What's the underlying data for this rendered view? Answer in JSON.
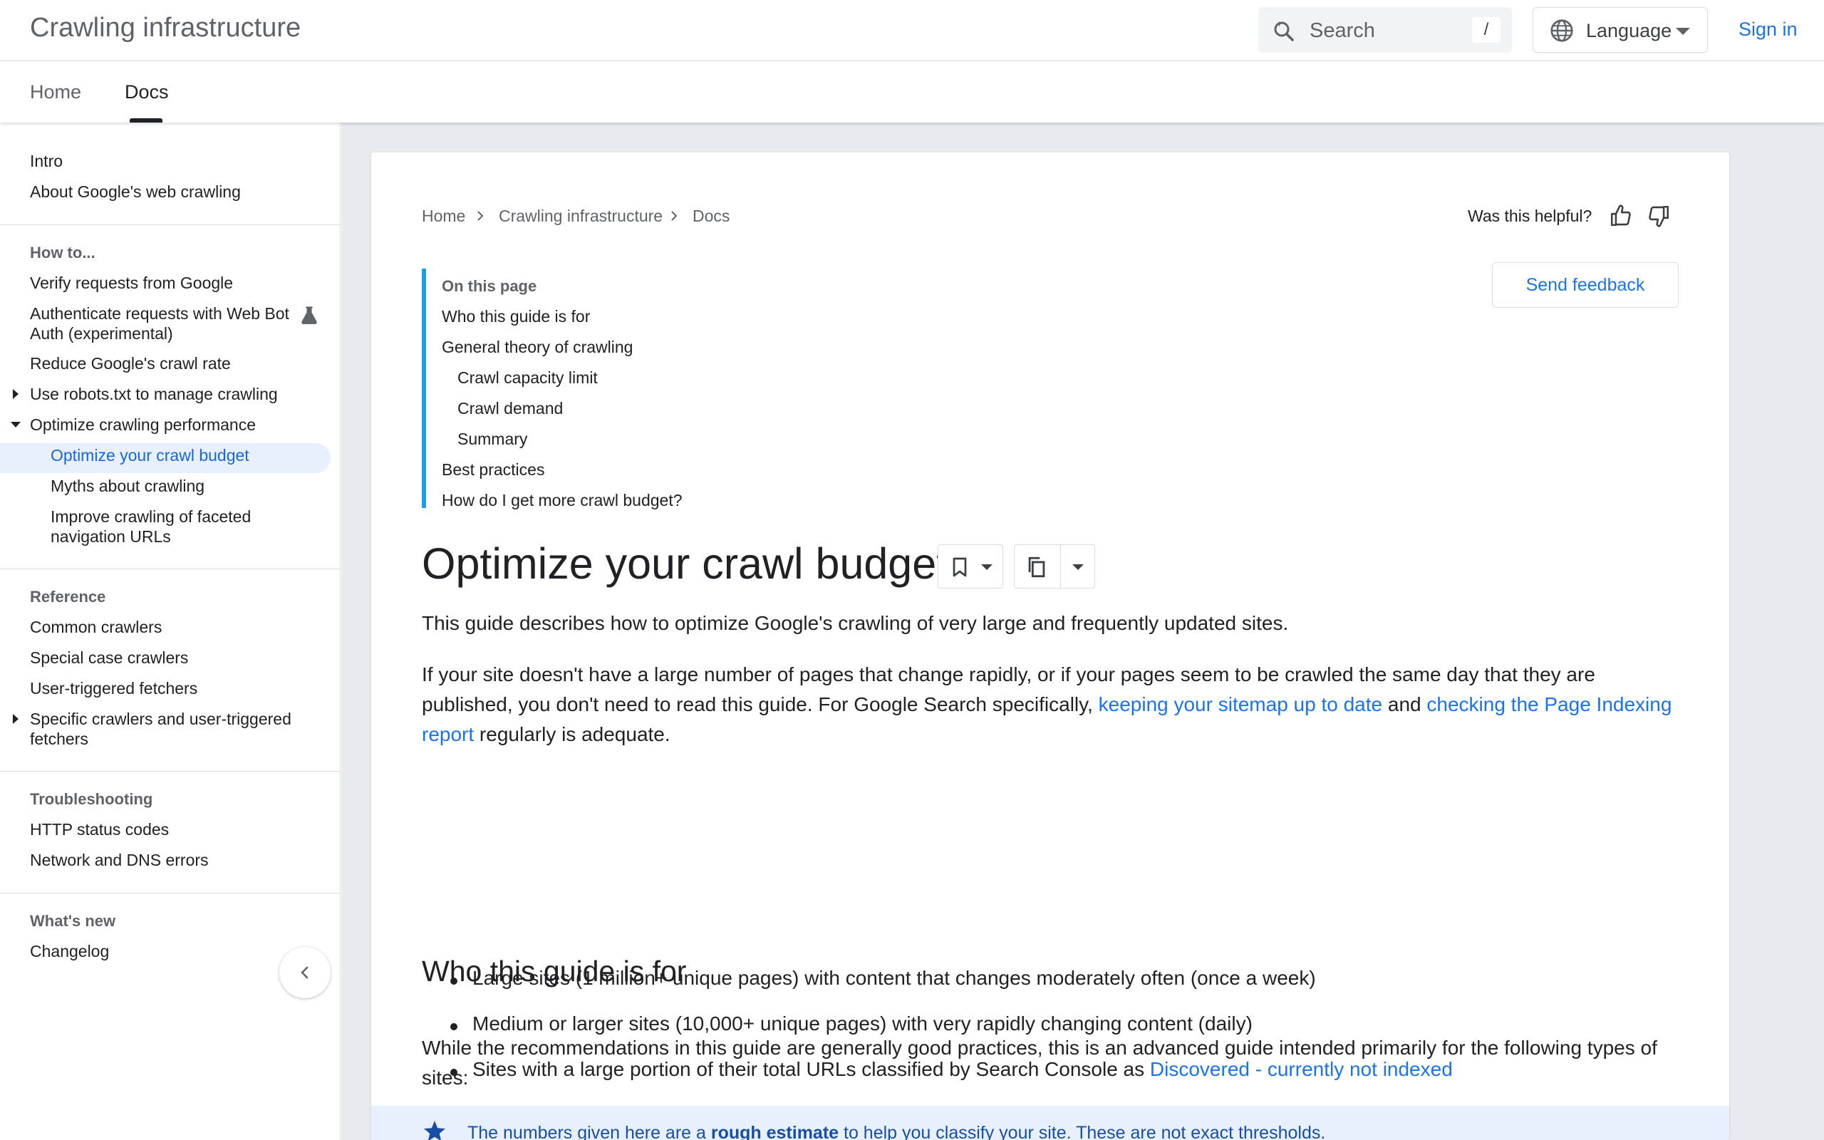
{
  "header": {
    "site_title": "Crawling infrastructure",
    "search_placeholder": "Search",
    "search_shortcut": "/",
    "language_label": "Language",
    "signin_label": "Sign in"
  },
  "tabs": [
    {
      "label": "Home",
      "active": false
    },
    {
      "label": "Docs",
      "active": true
    }
  ],
  "sidebar": {
    "intro": "Intro",
    "about": "About Google's web crawling",
    "howto_heading": "How to...",
    "verify": "Verify requests from Google",
    "authenticate": "Authenticate requests with Web Bot Auth (experimental)",
    "reduce": "Reduce Google's crawl rate",
    "robots": "Use robots.txt to manage crawling",
    "optimize": "Optimize crawling performance",
    "optimize_budget": "Optimize your crawl budget",
    "myths": "Myths about crawling",
    "faceted": "Improve crawling of faceted navigation URLs",
    "reference_heading": "Reference",
    "common": "Common crawlers",
    "special": "Special case crawlers",
    "user_triggered": "User-triggered fetchers",
    "specific": "Specific crawlers and user-triggered fetchers",
    "troubleshooting_heading": "Troubleshooting",
    "http": "HTTP status codes",
    "network": "Network and DNS errors",
    "whatsnew_heading": "What's new",
    "changelog": "Changelog"
  },
  "breadcrumb": [
    "Home",
    "Crawling infrastructure",
    "Docs"
  ],
  "helpful_label": "Was this helpful?",
  "feedback_label": "Send feedback",
  "toc": {
    "title": "On this page",
    "items": [
      "Who this guide is for",
      "General theory of crawling",
      "Crawl capacity limit",
      "Crawl demand",
      "Summary",
      "Best practices",
      "How do I get more crawl budget?"
    ]
  },
  "article": {
    "title": "Optimize your crawl budget",
    "intro": "This guide describes how to optimize Google's crawling of very large and frequently updated sites.",
    "p2_before": "If your site doesn't have a large number of pages that change rapidly, or if your pages seem to be crawled the same day that they are published, you don't need to read this guide. For Google Search specifically, ",
    "p2_link1": "keeping your sitemap up to date",
    "p2_mid": " and ",
    "p2_link2": "checking the Page Indexing report",
    "p2_after": " regularly is adequate.",
    "h2": "Who this guide is for",
    "p3": "While the recommendations in this guide are generally good practices, this is an advanced guide intended primarily for the following types of sites:",
    "bullet1": "Large sites (1 million+ unique pages) with content that changes moderately often (once a week)",
    "bullet2": "Medium or larger sites (10,000+ unique pages) with very rapidly changing content (daily)",
    "bullet3_before": "Sites with a large portion of their total URLs classified by Search Console as ",
    "bullet3_link": "Discovered - currently not indexed",
    "note_before": "The numbers given here are a ",
    "note_bold": "rough estimate",
    "note_after": " to help you classify your site. These are not exact thresholds."
  },
  "colors": {
    "accent": "#1a73e8",
    "active_nav_bg": "#e8f0fe",
    "toc_bar": "#1a9fe0",
    "page_bg": "#e8eaed"
  }
}
